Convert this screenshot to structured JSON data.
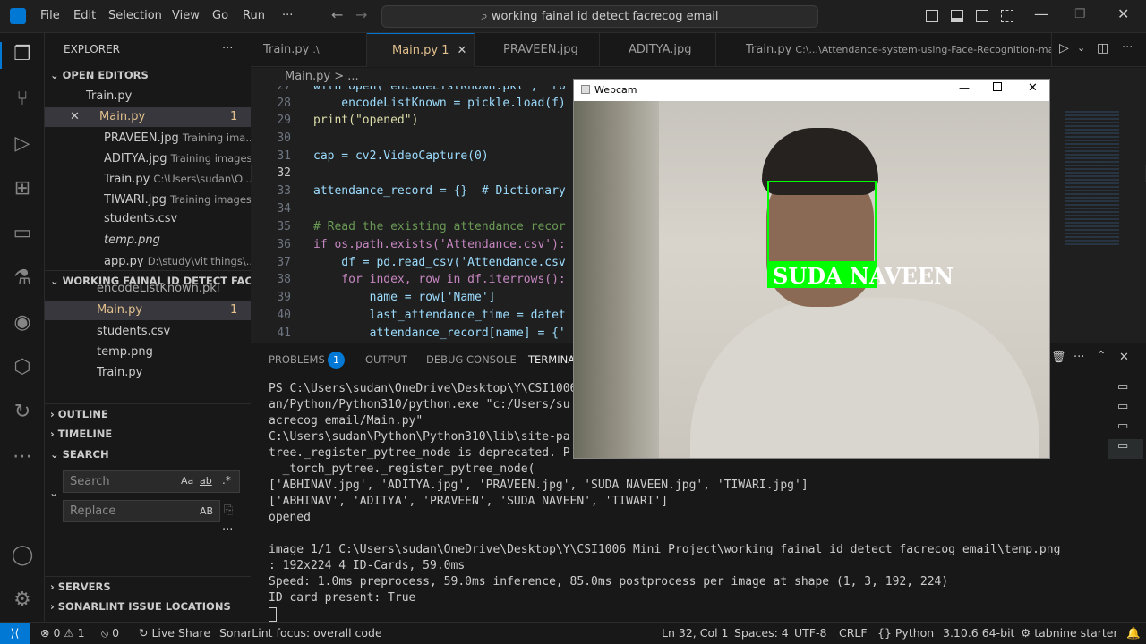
{
  "menu": [
    "File",
    "Edit",
    "Selection",
    "View",
    "Go",
    "Run",
    "···"
  ],
  "command_center": "working fainal id detect facrecog email",
  "explorer": {
    "title": "EXPLORER",
    "open_editors_label": "OPEN EDITORS",
    "open_editors": [
      {
        "name": "Train.py",
        "desc": ""
      },
      {
        "name": "Main.py",
        "desc": "",
        "badge": "1"
      },
      {
        "name": "PRAVEEN.jpg",
        "desc": "Training ima..."
      },
      {
        "name": "ADITYA.jpg",
        "desc": "Training images"
      },
      {
        "name": "Train.py",
        "desc": "C:\\Users\\sudan\\O..."
      },
      {
        "name": "TIWARI.jpg",
        "desc": "Training images"
      },
      {
        "name": "students.csv",
        "desc": ""
      },
      {
        "name": "temp.png",
        "desc": ""
      },
      {
        "name": "app.py",
        "desc": "D:\\study\\vit things\\..."
      }
    ],
    "folder_label": "WORKING FAINAL ID DETECT FACRE...",
    "folder_items": [
      {
        "name": "encodeListKnown.pkl"
      },
      {
        "name": "Main.py",
        "badge": "1"
      },
      {
        "name": "students.csv"
      },
      {
        "name": "temp.png"
      },
      {
        "name": "Train.py"
      }
    ],
    "outline": "OUTLINE",
    "timeline": "TIMELINE",
    "search": "SEARCH",
    "search_placeholder": "Search",
    "replace_placeholder": "Replace",
    "search_opts": "Aa",
    "search_opts2": "ab",
    "replace_opt": "AB",
    "servers": "SERVERS",
    "sonarlint": "SONARLINT ISSUE LOCATIONS"
  },
  "tabs": [
    {
      "label": "Train.py",
      "extra": ".\\"
    },
    {
      "label": "Main.py",
      "extra": "1"
    },
    {
      "label": "PRAVEEN.jpg",
      "extra": ""
    },
    {
      "label": "ADITYA.jpg",
      "extra": ""
    },
    {
      "label": "Train.py",
      "extra": "C:\\...\\Attendance-system-using-Face-Recognition-mai"
    }
  ],
  "breadcrumb": {
    "file": "Main.py",
    "rest": "> ..."
  },
  "code": [
    {
      "n": "27",
      "t": "with open('encodeListKnown.pkl', 'rb"
    },
    {
      "n": "28",
      "t": "    encodeListKnown = pickle.load(f)"
    },
    {
      "n": "29",
      "t": "print(\"opened\")"
    },
    {
      "n": "30",
      "t": ""
    },
    {
      "n": "31",
      "t": "cap = cv2.VideoCapture(0)"
    },
    {
      "n": "32",
      "t": ""
    },
    {
      "n": "33",
      "t": "attendance_record = {}  # Dictionary"
    },
    {
      "n": "34",
      "t": ""
    },
    {
      "n": "35",
      "t": "# Read the existing attendance recor"
    },
    {
      "n": "36",
      "t": "if os.path.exists('Attendance.csv'):"
    },
    {
      "n": "37",
      "t": "    df = pd.read_csv('Attendance.csv"
    },
    {
      "n": "38",
      "t": "    for index, row in df.iterrows():"
    },
    {
      "n": "39",
      "t": "        name = row['Name']"
    },
    {
      "n": "40",
      "t": "        last_attendance_time = datet"
    },
    {
      "n": "41",
      "t": "        attendance_record[name] = {'"
    }
  ],
  "panel": {
    "tabs": [
      "PROBLEMS",
      "OUTPUT",
      "DEBUG CONSOLE",
      "TERMINAL"
    ],
    "problems_badge": "1",
    "terminal": [
      "PS C:\\Users\\sudan\\OneDrive\\Desktop\\Y\\CSI1006                                                   /sud",
      "an/Python/Python310/python.exe \"c:/Users/su                                                      ct f",
      "acrecog email/Main.py\"",
      "C:\\Users\\sudan\\Python\\Python310\\lib\\site-pa                                                    ._py",
      "tree._register_pytree_node is deprecated. P",
      "  _torch_pytree._register_pytree_node(",
      "['ABHINAV.jpg', 'ADITYA.jpg', 'PRAVEEN.jpg', 'SUDA NAVEEN.jpg', 'TIWARI.jpg']",
      "['ABHINAV', 'ADITYA', 'PRAVEEN', 'SUDA NAVEEN', 'TIWARI']",
      "opened",
      "",
      "image 1/1 C:\\Users\\sudan\\OneDrive\\Desktop\\Y\\CSI1006 Mini Project\\working fainal id detect facrecog email\\temp.png",
      ": 192x224 4 ID-Cards, 59.0ms",
      "Speed: 1.0ms preprocess, 59.0ms inference, 85.0ms postprocess per image at shape (1, 3, 192, 224)",
      "ID card present: True"
    ]
  },
  "webcam": {
    "title": "Webcam",
    "label": "SUDA NAVEEN"
  },
  "status": {
    "errors": "0",
    "warnings": "1",
    "ports": "0",
    "liveshare": "Live Share",
    "sonar": "SonarLint focus: overall code",
    "position": "Ln 32, Col 1",
    "spaces": "Spaces: 4",
    "encoding": "UTF-8",
    "eol": "CRLF",
    "language": "Python",
    "interpreter": "3.10.6 64-bit",
    "tabnine": "tabnine starter"
  }
}
